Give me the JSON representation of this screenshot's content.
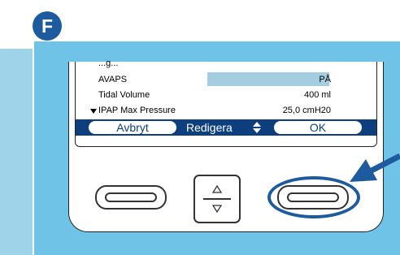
{
  "step_label": "F",
  "screen": {
    "partial_row_text": "...g...",
    "rows": [
      {
        "name": "AVAPS",
        "value": "PÅ"
      },
      {
        "name": "Tidal Volume",
        "value": "400 ml"
      },
      {
        "name": "IPAP Max Pressure",
        "value": "25,0 cmH20"
      }
    ],
    "softkeys": {
      "cancel": "Avbryt",
      "edit": "Redigera",
      "ok": "OK"
    }
  },
  "icons": [
    "down-arrow-icon",
    "up-down-arrow-icon",
    "nav-up-icon",
    "nav-down-icon",
    "pointer-arrow-icon"
  ],
  "colors": {
    "panel": "#6fc3e7",
    "side_strip": "#9fd3ea",
    "badge": "#1e5b9e",
    "softbar": "#0d3f7e",
    "highlight": "#a5cde2"
  }
}
